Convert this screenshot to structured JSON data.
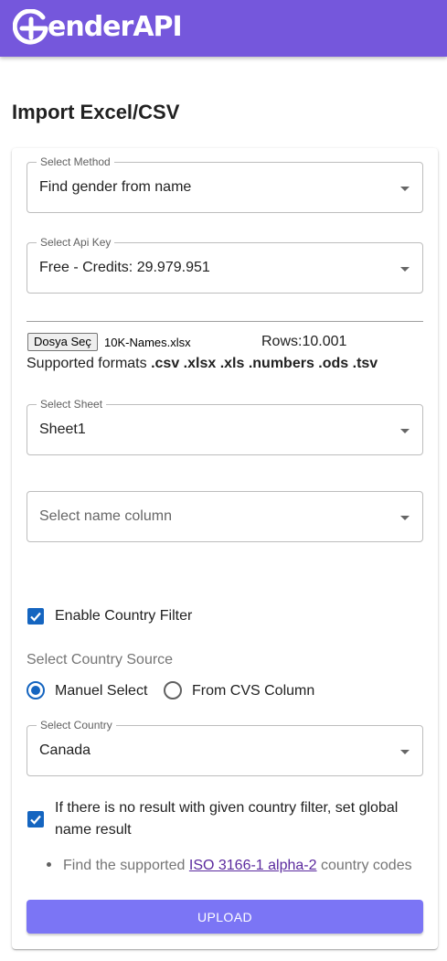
{
  "header": {
    "logo_text": "enderAPI"
  },
  "page": {
    "title": "Import Excel/CSV"
  },
  "method": {
    "legend": "Select Method",
    "value": "Find gender from name"
  },
  "api_key": {
    "legend": "Select Api Key",
    "value": "Free - Credits: 29.979.951"
  },
  "file": {
    "button_label": "Dosya Seç",
    "file_name": "10K-Names.xlsx",
    "rows": "Rows:10.001",
    "formats_prefix": "Supported formats",
    "formats_list": ".csv .xlsx .xls .numbers .ods .tsv"
  },
  "sheet": {
    "legend": "Select Sheet",
    "value": "Sheet1"
  },
  "name_column": {
    "placeholder": "Select name column"
  },
  "country_filter": {
    "label": "Enable Country Filter",
    "checked": true
  },
  "country_source": {
    "label": "Select Country Source",
    "options": [
      {
        "label": "Manuel Select",
        "selected": true
      },
      {
        "label": "From CVS Column",
        "selected": false
      }
    ]
  },
  "country": {
    "legend": "Select Country",
    "value": "Canada"
  },
  "global_fallback": {
    "label": "If there is no result with given country filter, set global name result",
    "checked": true
  },
  "note": {
    "prefix": "Find the supported",
    "link": "ISO 3166-1 alpha-2",
    "suffix": "country codes"
  },
  "upload": {
    "label": "UPLOAD"
  },
  "colors": {
    "header": "#7557dc",
    "primary": "#1565c0",
    "upload": "#7b75f5",
    "link": "#5b2a9e"
  }
}
